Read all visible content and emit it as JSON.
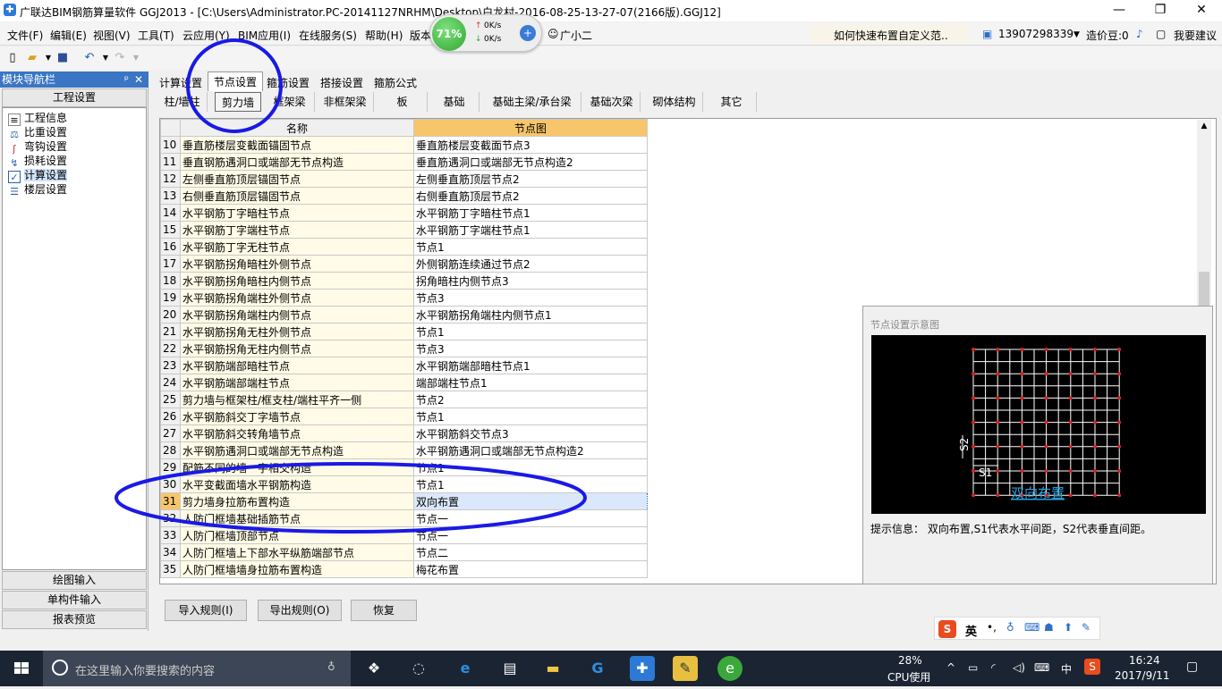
{
  "window": {
    "title": "广联达BIM钢筋算量软件 GGJ2013 - [C:\\Users\\Administrator.PC-20141127NRHM\\Desktop\\白龙村-2016-08-25-13-27-07(2166版).GGJ12]",
    "min": "—",
    "restore": "❐",
    "close": "✕"
  },
  "menu": {
    "items": [
      "文件(F)",
      "编辑(E)",
      "视图(V)",
      "工具(T)",
      "云应用(Y)",
      "BIM应用(I)",
      "在线服务(S)",
      "帮助(H)",
      "版本"
    ],
    "assistant": "广小二",
    "question": "如何快速布置自定义范..",
    "phone": "13907298339",
    "beans": "造价豆:0",
    "suggest": "我要建议"
  },
  "speed_widget": {
    "percent": "71%",
    "up_rate": "0K/s",
    "down_rate": "0K/s"
  },
  "nav": {
    "title": "模块导航栏",
    "pin": "ᵖ",
    "close": "✕",
    "section": "工程设置",
    "items": [
      "工程信息",
      "比重设置",
      "弯钩设置",
      "损耗设置",
      "计算设置",
      "楼层设置"
    ],
    "selected": "计算设置",
    "bottom": [
      "绘图输入",
      "单构件输入",
      "报表预览"
    ]
  },
  "tabs": {
    "primary": [
      "计算设置",
      "节点设置",
      "箍筋设置",
      "搭接设置",
      "箍筋公式"
    ],
    "primary_active": "节点设置",
    "secondary": [
      "柱/墙柱",
      "剪力墙",
      "框架梁",
      "非框架梁",
      "板",
      "基础",
      "基础主梁/承台梁",
      "基础次梁",
      "砌体结构",
      "其它"
    ],
    "secondary_active": "剪力墙"
  },
  "table": {
    "headers": [
      "名称",
      "节点图"
    ],
    "selected_row": "31",
    "rows": [
      {
        "no": "10",
        "name": "垂直筋楼层变截面锚固节点",
        "node": "垂直筋楼层变截面节点3"
      },
      {
        "no": "11",
        "name": "垂直钢筋遇洞口或端部无节点构造",
        "node": "垂直筋遇洞口或端部无节点构造2"
      },
      {
        "no": "12",
        "name": "左侧垂直筋顶层锚固节点",
        "node": "左侧垂直筋顶层节点2"
      },
      {
        "no": "13",
        "name": "右侧垂直筋顶层锚固节点",
        "node": "右侧垂直筋顶层节点2"
      },
      {
        "no": "14",
        "name": "水平钢筋丁字暗柱节点",
        "node": "水平钢筋丁字暗柱节点1"
      },
      {
        "no": "15",
        "name": "水平钢筋丁字端柱节点",
        "node": "水平钢筋丁字端柱节点1"
      },
      {
        "no": "16",
        "name": "水平钢筋丁字无柱节点",
        "node": "节点1"
      },
      {
        "no": "17",
        "name": "水平钢筋拐角暗柱外侧节点",
        "node": "外侧钢筋连续通过节点2"
      },
      {
        "no": "18",
        "name": "水平钢筋拐角暗柱内侧节点",
        "node": "拐角暗柱内侧节点3"
      },
      {
        "no": "19",
        "name": "水平钢筋拐角端柱外侧节点",
        "node": "节点3"
      },
      {
        "no": "20",
        "name": "水平钢筋拐角端柱内侧节点",
        "node": "水平钢筋拐角端柱内侧节点1"
      },
      {
        "no": "21",
        "name": "水平钢筋拐角无柱外侧节点",
        "node": "节点1"
      },
      {
        "no": "22",
        "name": "水平钢筋拐角无柱内侧节点",
        "node": "节点3"
      },
      {
        "no": "23",
        "name": "水平钢筋端部暗柱节点",
        "node": "水平钢筋端部暗柱节点1"
      },
      {
        "no": "24",
        "name": "水平钢筋端部端柱节点",
        "node": "端部端柱节点1"
      },
      {
        "no": "25",
        "name": "剪力墙与框架柱/框支柱/端柱平齐一侧",
        "node": "节点2"
      },
      {
        "no": "26",
        "name": "水平钢筋斜交丁字墙节点",
        "node": "节点1"
      },
      {
        "no": "27",
        "name": "水平钢筋斜交转角墙节点",
        "node": "水平钢筋斜交节点3"
      },
      {
        "no": "28",
        "name": "水平钢筋遇洞口或端部无节点构造",
        "node": "水平钢筋遇洞口或端部无节点构造2"
      },
      {
        "no": "29",
        "name": "配筋不同的墙一字相交构造",
        "node": "节点1"
      },
      {
        "no": "30",
        "name": "水平变截面墙水平钢筋构造",
        "node": "节点1"
      },
      {
        "no": "31",
        "name": "剪力墙身拉筋布置构造",
        "node": "双向布置"
      },
      {
        "no": "32",
        "name": "人防门框墙基础插筋节点",
        "node": "节点一"
      },
      {
        "no": "33",
        "name": "人防门框墙顶部节点",
        "node": "节点一"
      },
      {
        "no": "34",
        "name": "人防门框墙上下部水平纵筋端部节点",
        "node": "节点二"
      },
      {
        "no": "35",
        "name": "人防门框墙墙身拉筋布置构造",
        "node": "梅花布置"
      }
    ]
  },
  "diagram": {
    "title": "节点设置示意图",
    "s1_label": "S1",
    "s2_label": "S2",
    "caption": "双向布置",
    "hint": "提示信息：  双向布置,S1代表水平间距，S2代表垂直间距。",
    "grid_color": "#ffffff",
    "dot_color": "#e02020",
    "caption_color": "#29a3e0"
  },
  "buttons": {
    "import": "导入规则(I)",
    "export": "导出规则(O)",
    "restore": "恢复"
  },
  "ime": {
    "logo": "S",
    "lang": "英"
  },
  "taskbar": {
    "search_placeholder": "在这里输入你要搜索的内容",
    "cpu_percent": "28%",
    "cpu_label": "CPU使用",
    "lang": "中",
    "time": "16:24",
    "date": "2017/9/11"
  },
  "annotations": {
    "circle_color": "#1a1ae6"
  }
}
